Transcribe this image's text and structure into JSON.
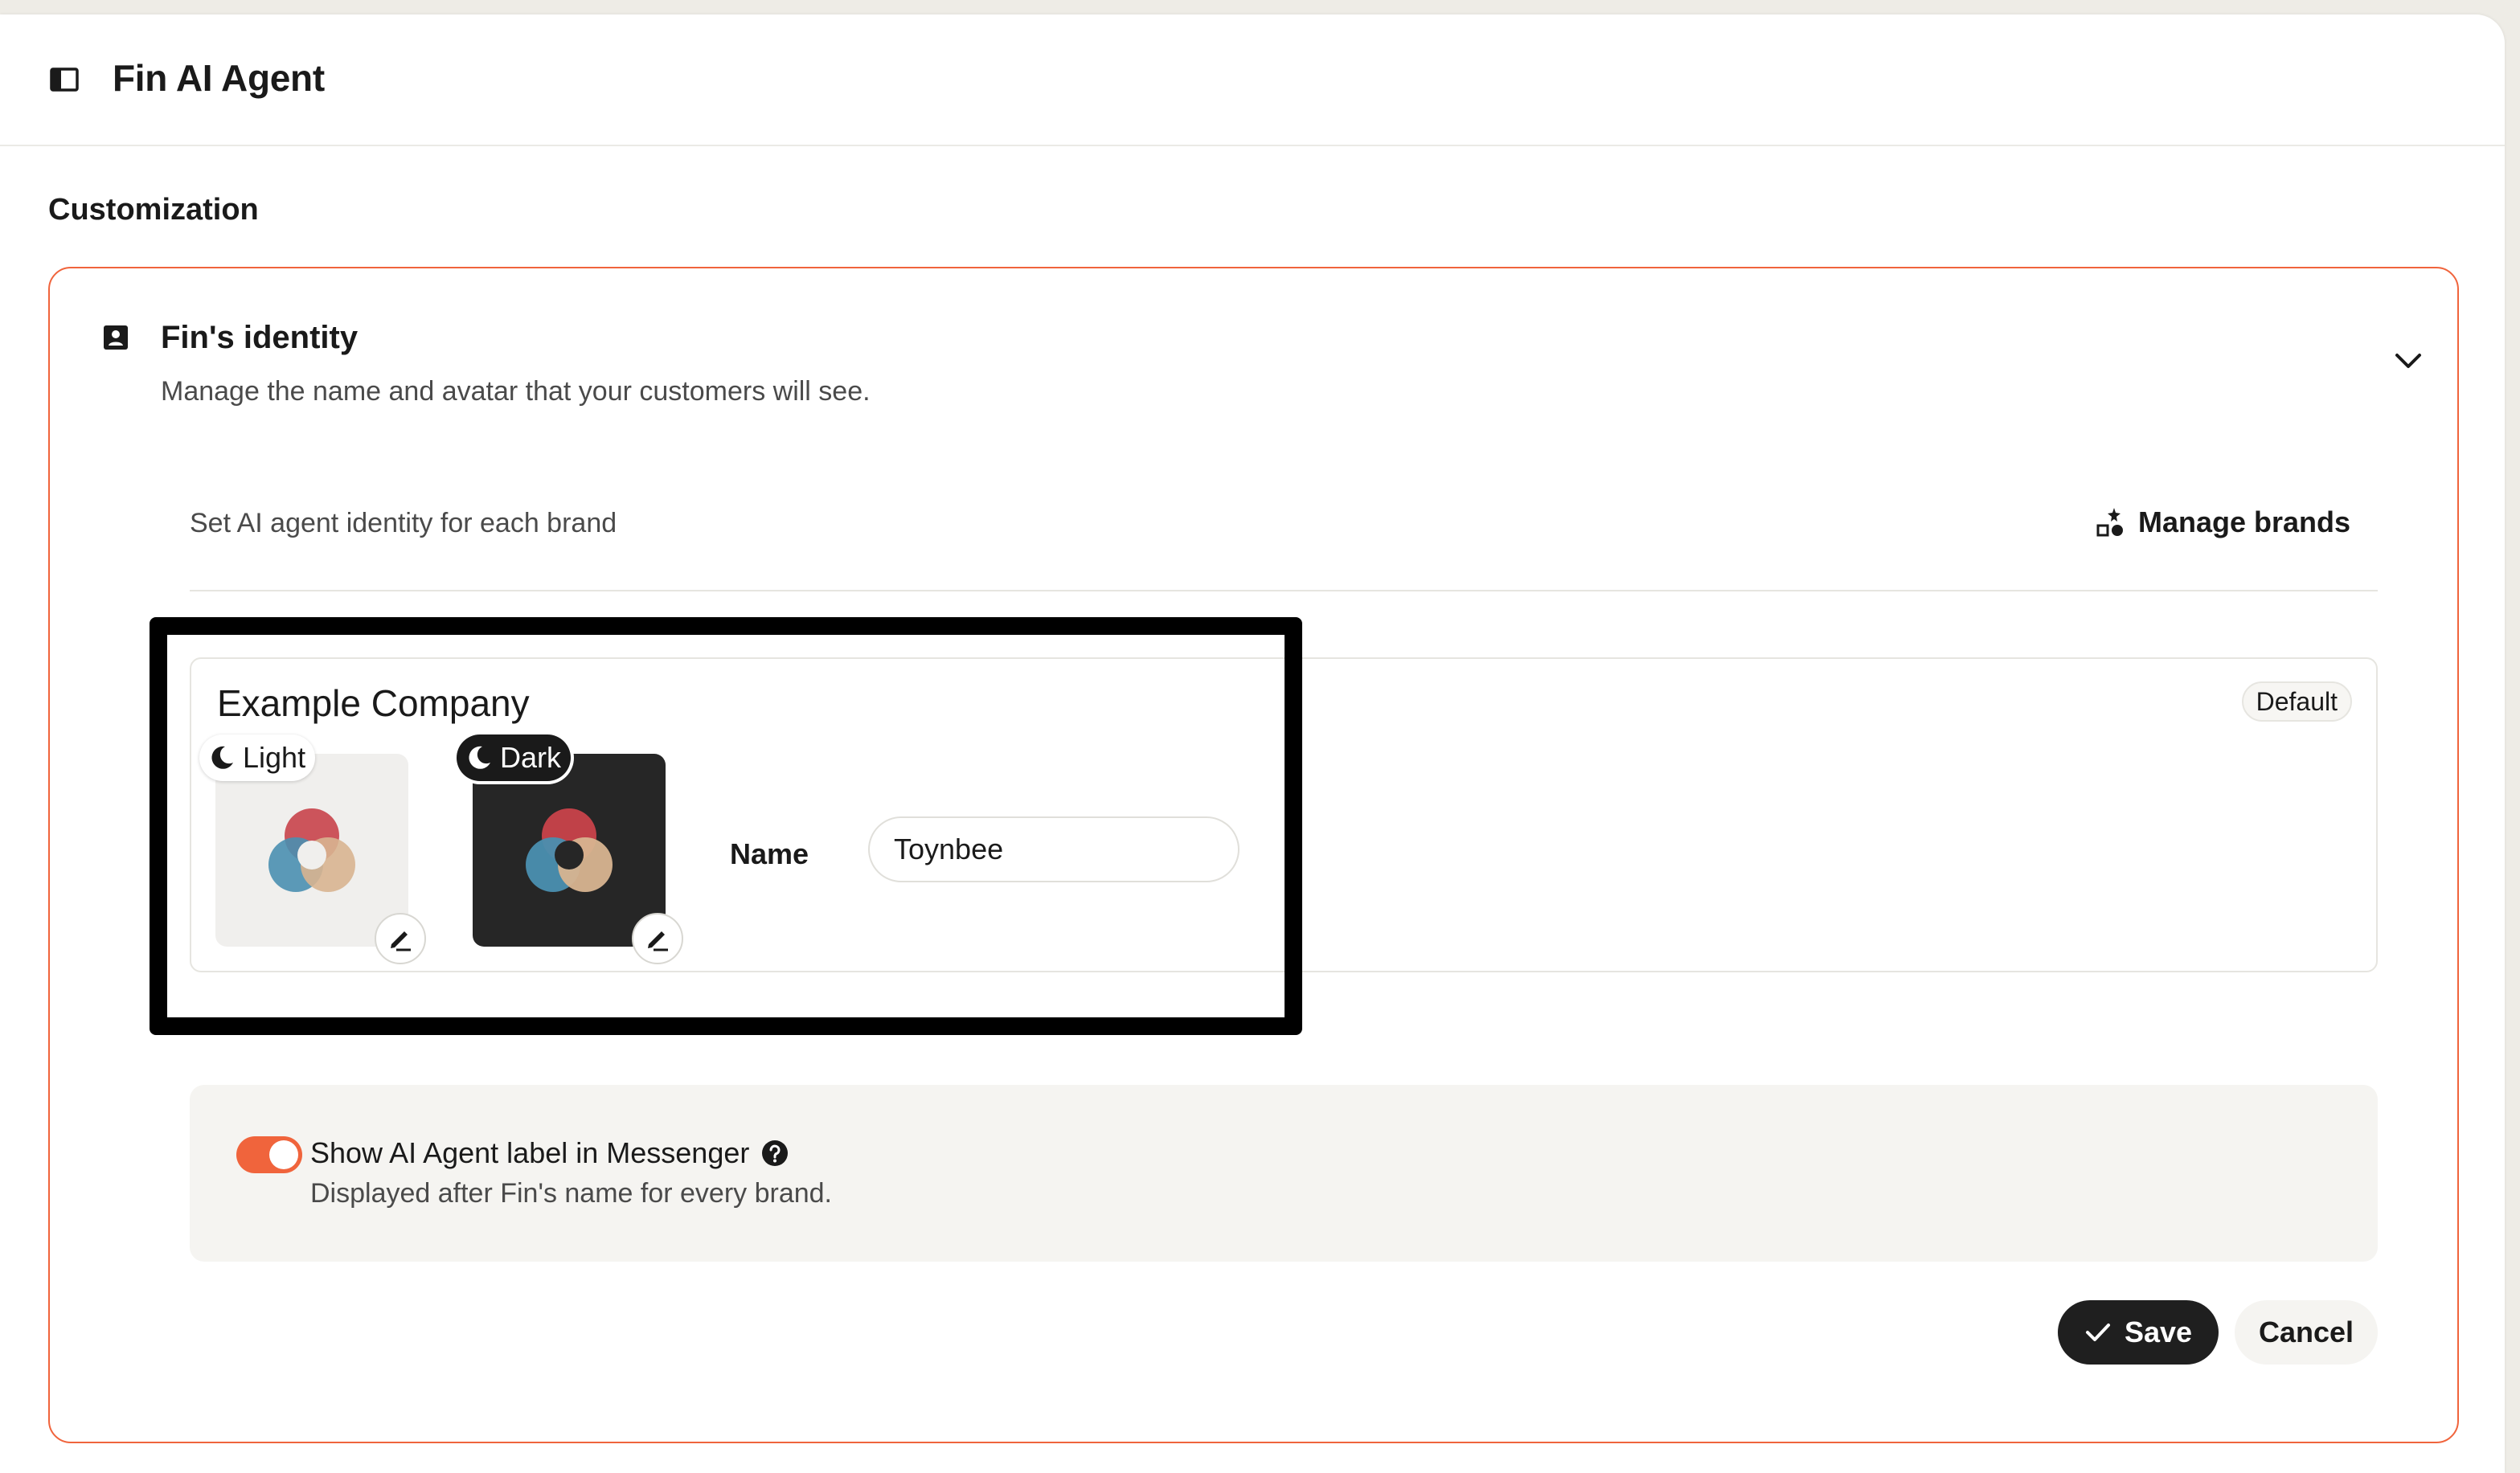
{
  "header": {
    "title": "Fin AI Agent",
    "icon": "sidebar-toggle-icon"
  },
  "section": {
    "title": "Customization"
  },
  "identity": {
    "title": "Fin's identity",
    "subtitle": "Manage the name and avatar that your customers will see.",
    "icon": "contact-card-icon",
    "expanded": true
  },
  "brands": {
    "row_label": "Set AI agent identity for each brand",
    "manage_label": "Manage brands",
    "items": [
      {
        "company": "Example Company",
        "badge": "Default",
        "light_label": "Light",
        "dark_label": "Dark",
        "name_label": "Name",
        "name_value": "Toynbee"
      }
    ]
  },
  "ai_label": {
    "toggle_on": true,
    "title": "Show AI Agent label in Messenger",
    "subtitle": "Displayed after Fin's name for every brand."
  },
  "actions": {
    "save_label": "Save",
    "cancel_label": "Cancel"
  },
  "colors": {
    "accent": "#f0643c",
    "primary_button": "#1f1f1f",
    "panel_bg": "#f5f4f1",
    "logo_red": "#c8424a",
    "logo_blue": "#4a8fb0",
    "logo_tan": "#d8b490"
  }
}
